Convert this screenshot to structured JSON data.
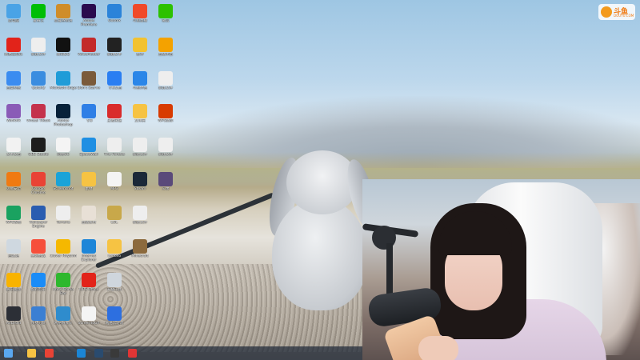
{
  "watermark": {
    "brand": "斗鱼",
    "url": "DOUYU.COM"
  },
  "desktop_icons": [
    {
      "label": "此电脑",
      "icon": "computer-icon",
      "color": "#4aa3e6"
    },
    {
      "label": "网易云音乐",
      "icon": "netease-music-icon",
      "color": "#e2231a"
    },
    {
      "label": "百度网盘",
      "icon": "baidu-netdisk-icon",
      "color": "#3b8cf0"
    },
    {
      "label": "WinRAR",
      "icon": "winrar-icon",
      "color": "#8a5bb7"
    },
    {
      "label": "文本文档",
      "icon": "document-icon",
      "color": "#f2f2f2"
    },
    {
      "label": "火绒安全",
      "icon": "huorong-icon",
      "color": "#f07a12"
    },
    {
      "label": "WPS表格",
      "icon": "spreadsheet-icon",
      "color": "#1aa260"
    },
    {
      "label": "回收站",
      "icon": "recycle-bin-icon",
      "color": "#cfd8e0"
    },
    {
      "label": "腾讯视频",
      "icon": "tencent-video-icon",
      "color": "#f8b300"
    },
    {
      "label": "AirDroid",
      "icon": "airdroid-icon",
      "color": "#2c2f36"
    },
    {
      "label": "爱奇艺",
      "icon": "iqiyi-icon",
      "color": "#00be06"
    },
    {
      "label": "新建文件",
      "icon": "file-icon",
      "color": "#eeeeee"
    },
    {
      "label": "QuickQ",
      "icon": "quickq-icon",
      "color": "#3a8de0"
    },
    {
      "label": "Virtual Tiktok",
      "icon": "anime-avatar-icon",
      "color": "#c4324c"
    },
    {
      "label": "OBS Studio",
      "icon": "obs-icon",
      "color": "#1d1d1d"
    },
    {
      "label": "Google Chrome",
      "icon": "chrome-icon",
      "color": "#e94335"
    },
    {
      "label": "Wallpaper Engine",
      "icon": "wallpaper-engine-icon",
      "color": "#2a5db0"
    },
    {
      "label": "腾讯会议",
      "icon": "meeting-icon",
      "color": "#f64f3b"
    },
    {
      "label": "酷狗音乐",
      "icon": "kugou-icon",
      "color": "#1a8cf7"
    },
    {
      "label": "快捷方式",
      "icon": "window-icon",
      "color": "#3b7fd3"
    },
    {
      "label": "星露谷物语",
      "icon": "stardew-icon",
      "color": "#cf8d2a"
    },
    {
      "label": "腾讯QQ",
      "icon": "qq-icon",
      "color": "#111111"
    },
    {
      "label": "Microsoft Edge",
      "icon": "edge-icon",
      "color": "#1f9cd8"
    },
    {
      "label": "Adobe Photoshop",
      "icon": "photoshop-icon",
      "color": "#07213a"
    },
    {
      "label": "网易UU",
      "icon": "uu-icon",
      "color": "#f4f4f4"
    },
    {
      "label": "Screenshot",
      "icon": "diamond-icon",
      "color": "#1aa3d8"
    },
    {
      "label": "Terraria",
      "icon": "file-icon",
      "color": "#eeeeee"
    },
    {
      "label": "Clover Rhythm",
      "icon": "leaf-icon",
      "color": "#f5b800"
    },
    {
      "label": "Xbox Game Bar",
      "icon": "xbox-icon",
      "color": "#2eb82e"
    },
    {
      "label": "网络摄像头",
      "icon": "camera-icon",
      "color": "#2f8ccd"
    },
    {
      "label": "Adobe Premiere",
      "icon": "premiere-icon",
      "color": "#2a0a4d"
    },
    {
      "label": "VoiceMeeter",
      "icon": "voicemeeter-icon",
      "color": "#c32a2a"
    },
    {
      "label": "Don't Starve",
      "icon": "game-icon",
      "color": "#7a5a3a"
    },
    {
      "label": "飞书",
      "icon": "bird-icon",
      "color": "#2f7fe6"
    },
    {
      "label": "SpaceWall",
      "icon": "mountain-icon",
      "color": "#1f8fe3"
    },
    {
      "label": "素材",
      "icon": "folder-icon",
      "color": "#f6c343"
    },
    {
      "label": "直播素材",
      "icon": "photo-icon",
      "color": "#e8e0d6"
    },
    {
      "label": "Internet Explorer",
      "icon": "ie-icon",
      "color": "#1e86d8"
    },
    {
      "label": "WPS Office",
      "icon": "wps-icon",
      "color": "#e2231a"
    },
    {
      "label": "ScreenToGif",
      "icon": "gif-icon",
      "color": "#f4f4f4"
    },
    {
      "label": "Goodix",
      "icon": "camera-icon",
      "color": "#2b83d9"
    },
    {
      "label": "新建文本",
      "icon": "phone-icon",
      "color": "#222222"
    },
    {
      "label": "飞书文档",
      "icon": "pen-icon",
      "color": "#2a7ef2"
    },
    {
      "label": "王者荣耀",
      "icon": "character-icon",
      "color": "#d92b2b"
    },
    {
      "label": "The Forests",
      "icon": "file-icon",
      "color": "#eeeeee"
    },
    {
      "label": "MP3",
      "icon": "mp3-icon",
      "color": "#f4f4f4"
    },
    {
      "label": "LOL",
      "icon": "lol-icon",
      "color": "#c8a84a"
    },
    {
      "label": "Lenovo",
      "icon": "folder-icon",
      "color": "#f6c343"
    },
    {
      "label": "开播工具",
      "icon": "archive-icon",
      "color": "#cfd6dd"
    },
    {
      "label": "网易云游戏",
      "icon": "dropbox-icon",
      "color": "#2d6fe0"
    },
    {
      "label": "斗鱼直播",
      "icon": "bird-icon",
      "color": "#f04a2a"
    },
    {
      "label": "原神",
      "icon": "leaf-icon",
      "color": "#f2c230"
    },
    {
      "label": "斗鱼伴侣",
      "icon": "feather-icon",
      "color": "#2a86e8"
    },
    {
      "label": "文件夹",
      "icon": "folder-icon",
      "color": "#f6c343"
    },
    {
      "label": "新建文件",
      "icon": "file-icon",
      "color": "#eeeeee"
    },
    {
      "label": "Steam",
      "icon": "steam-icon",
      "color": "#1b2838"
    },
    {
      "label": "新建文件",
      "icon": "file-icon",
      "color": "#eeeeee"
    },
    {
      "label": "Minecraft",
      "icon": "minecraft-icon",
      "color": "#8c6a3d"
    },
    {
      "label": "微信",
      "icon": "wechat-icon",
      "color": "#2dc100"
    },
    {
      "label": "直播伴侣",
      "icon": "uu-icon",
      "color": "#f4a200"
    },
    {
      "label": "新建文件",
      "icon": "file-icon",
      "color": "#eeeeee"
    },
    {
      "label": "WPS演示",
      "icon": "presentation-icon",
      "color": "#d83b01"
    },
    {
      "label": "新建文件",
      "icon": "file-icon",
      "color": "#eeeeee"
    },
    {
      "label": "头像",
      "icon": "avatar-icon",
      "color": "#5a4a7a"
    }
  ],
  "taskbar_icons": [
    {
      "name": "start-button",
      "color": "#5aa8f0"
    },
    {
      "name": "file-explorer-icon",
      "color": "#f6c343"
    },
    {
      "name": "chrome-taskbar-icon",
      "color": "#e94335"
    },
    {
      "name": "photoshop-taskbar-icon",
      "color": "#1b86d6"
    },
    {
      "name": "steam-taskbar-icon",
      "color": "#2a4b6f"
    },
    {
      "name": "obs-taskbar-icon",
      "color": "#3a3a3a"
    },
    {
      "name": "qq-taskbar-icon",
      "color": "#e03535"
    }
  ]
}
